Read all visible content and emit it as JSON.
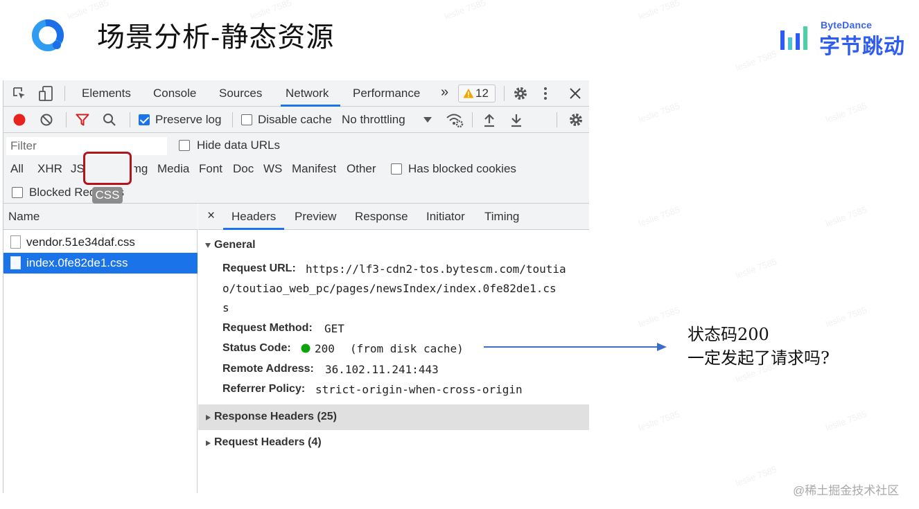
{
  "slide": {
    "title": "场景分析-静态资源",
    "brand_small": "ByteDance",
    "brand_big": "字节跳动"
  },
  "devtools": {
    "tabs": [
      "Elements",
      "Console",
      "Sources",
      "Network",
      "Performance"
    ],
    "active_tab": "Network",
    "more_panels_label": "»",
    "warnings_count": "12",
    "network_toolbar": {
      "preserve_log_label": "Preserve log",
      "preserve_log_checked": true,
      "disable_cache_label": "Disable cache",
      "disable_cache_checked": false,
      "throttling_value": "No throttling"
    },
    "filter": {
      "placeholder": "Filter",
      "hide_data_urls_label": "Hide data URLs",
      "types": [
        "All",
        "XHR",
        "JS",
        "CSS",
        "Img",
        "Media",
        "Font",
        "Doc",
        "WS",
        "Manifest",
        "Other"
      ],
      "active_type": "CSS",
      "has_blocked_cookies_label": "Has blocked cookies",
      "blocked_requests_label": "Blocked Requests"
    },
    "requests": {
      "name_header": "Name",
      "files": [
        {
          "name": "vendor.51e34daf.css",
          "selected": false
        },
        {
          "name": "index.0fe82de1.css",
          "selected": true
        }
      ]
    },
    "detail": {
      "close_label": "×",
      "tabs": [
        "Headers",
        "Preview",
        "Response",
        "Initiator",
        "Timing"
      ],
      "active_tab": "Headers",
      "general_title": "General",
      "request_url_label": "Request URL:",
      "request_url_lines": [
        "https://lf3-cdn2-tos.bytescm.com/toutia",
        "o/toutiao_web_pc/pages/newsIndex/index.0fe82de1.cs",
        "s"
      ],
      "request_method_label": "Request Method:",
      "request_method": "GET",
      "status_code_label": "Status Code:",
      "status_code": "200",
      "status_note": "(from disk cache)",
      "status_color": "#0ca30c",
      "remote_address_label": "Remote Address:",
      "remote_address": "36.102.11.241:443",
      "referrer_policy_label": "Referrer Policy:",
      "referrer_policy": "strict-origin-when-cross-origin",
      "response_headers_title": "Response Headers (25)",
      "request_headers_title": "Request Headers (4)"
    }
  },
  "annotation": {
    "line1": "状态码200",
    "line2": "一定发起了请求吗?",
    "arrow_color": "#3a6fc6"
  },
  "watermark_text": "leslie 7585",
  "credit": "@稀土掘金技术社区",
  "colors": {
    "accent_blue": "#1a73e8",
    "record_red": "#e8231f",
    "highlight_red": "#b3141c",
    "warning_yellow": "#f2a600"
  }
}
